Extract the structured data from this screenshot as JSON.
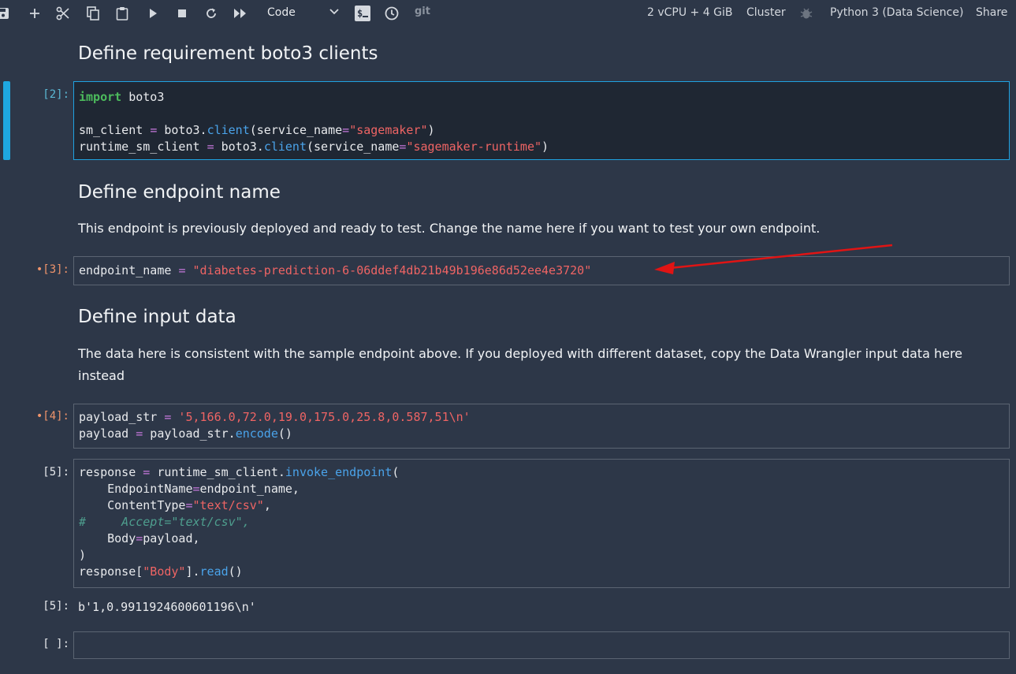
{
  "toolbar": {
    "cell_type": "Code",
    "git_label": "git",
    "instance": "2 vCPU + 4 GiB",
    "cluster": "Cluster",
    "kernel": "Python 3 (Data Science)",
    "share": "Share"
  },
  "cells": {
    "md1": {
      "heading": "Define requirement boto3 clients"
    },
    "code2": {
      "prompt": "[2]:",
      "l1_kw": "import",
      "l1_rest": " boto3",
      "l3_a": "sm_client ",
      "l3_op": "=",
      "l3_b": " boto3.",
      "l3_fn": "client",
      "l3_c": "(service_name",
      "l3_op2": "=",
      "l3_str": "\"sagemaker\"",
      "l3_d": ")",
      "l4_a": "runtime_sm_client ",
      "l4_op": "=",
      "l4_b": " boto3.",
      "l4_fn": "client",
      "l4_c": "(service_name",
      "l4_op2": "=",
      "l4_str": "\"sagemaker-runtime\"",
      "l4_d": ")"
    },
    "md2": {
      "heading": "Define endpoint name",
      "text": "This endpoint is previously deployed and ready to test. Change the name here if you want to test your own endpoint."
    },
    "code3": {
      "prompt": "•[3]:",
      "a": "endpoint_name ",
      "op": "=",
      "str": " \"diabetes-prediction-6-06ddef4db21b49b196e86d52ee4e3720\""
    },
    "md3": {
      "heading": "Define input data",
      "text": "The data here is consistent with the sample endpoint above. If you deployed with different dataset, copy the Data Wrangler input data here instead"
    },
    "code4": {
      "prompt": "•[4]:",
      "l1_a": "payload_str ",
      "l1_op": "=",
      "l1_str": " '5,166.0,72.0,19.0,175.0,25.8,0.587,51\\n'",
      "l2_a": "payload ",
      "l2_op": "=",
      "l2_b": " payload_str.",
      "l2_fn": "encode",
      "l2_c": "()"
    },
    "code5": {
      "prompt": "[5]:",
      "l1_a": "response ",
      "l1_op": "=",
      "l1_b": " runtime_sm_client.",
      "l1_fn": "invoke_endpoint",
      "l1_c": "(",
      "l2_a": "    EndpointName",
      "l2_op": "=",
      "l2_b": "endpoint_name,",
      "l3_a": "    ContentType",
      "l3_op": "=",
      "l3_str": "\"text/csv\"",
      "l3_b": ",",
      "l4_cm": "#     Accept=\"text/csv\",",
      "l5_a": "    Body",
      "l5_op": "=",
      "l5_b": "payload,",
      "l6": ")",
      "l7_a": "response[",
      "l7_str": "\"Body\"",
      "l7_b": "].",
      "l7_fn": "read",
      "l7_c": "()"
    },
    "out5": {
      "prompt": "[5]:",
      "text": "b'1,0.9911924600601196\\n'"
    },
    "empty": {
      "prompt": "[ ]:"
    }
  }
}
